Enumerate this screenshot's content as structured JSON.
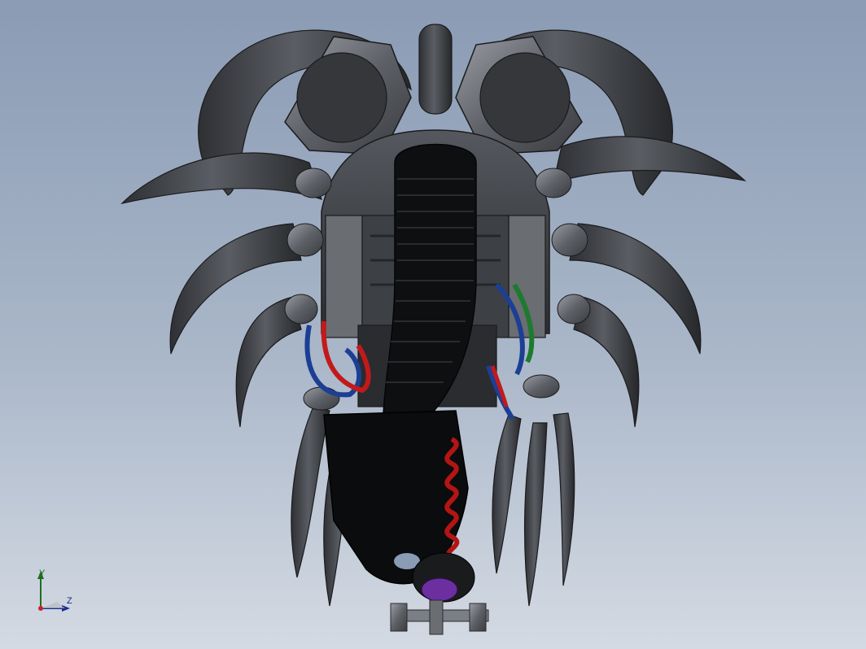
{
  "viewport": {
    "background_top": "#8a9bb4",
    "background_bottom": "#d4dae3"
  },
  "model": {
    "description_icon": "cad-assembly-robot-hand",
    "body_color": "#4a4d52",
    "dark_color": "#111214",
    "wire_colors": [
      "#c21a1a",
      "#1c3f94",
      "#1d7a2e",
      "#8a5a2b"
    ],
    "accent_color": "#6b2fa0"
  },
  "triad": {
    "y_label": "Y",
    "z_label": "Z",
    "y_color": "#1f6e1f",
    "z_color": "#1b2a8c",
    "x_color": "#c0262c"
  }
}
